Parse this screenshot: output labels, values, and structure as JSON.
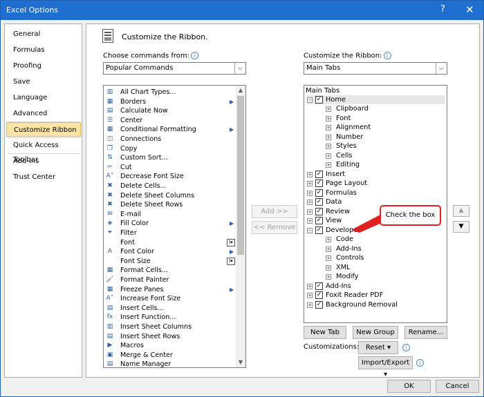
{
  "window": {
    "title": "Excel Options",
    "help_glyph": "?",
    "close_glyph": "✕"
  },
  "nav": {
    "items": [
      "General",
      "Formulas",
      "Proofing",
      "Save",
      "Language",
      "Advanced",
      "Customize Ribbon",
      "Quick Access Toolbar",
      "Add-Ins",
      "Trust Center"
    ],
    "selected": "Customize Ribbon"
  },
  "header": {
    "title": "Customize the Ribbon."
  },
  "left": {
    "label": "Choose commands from:",
    "combo_value": "Popular Commands",
    "commands": [
      {
        "label": "All Chart Types...",
        "icon": "chart-icon",
        "glyph": "▥"
      },
      {
        "label": "Borders",
        "icon": "borders-icon",
        "glyph": "▦",
        "submenu": true
      },
      {
        "label": "Calculate Now",
        "icon": "calculator-icon",
        "glyph": "▤"
      },
      {
        "label": "Center",
        "icon": "align-center-icon",
        "glyph": "☰"
      },
      {
        "label": "Conditional Formatting",
        "icon": "conditional-formatting-icon",
        "glyph": "▦",
        "submenu": true
      },
      {
        "label": "Connections",
        "icon": "connections-icon",
        "glyph": "◫"
      },
      {
        "label": "Copy",
        "icon": "copy-icon",
        "glyph": "❐"
      },
      {
        "label": "Custom Sort...",
        "icon": "sort-icon",
        "glyph": "⇅"
      },
      {
        "label": "Cut",
        "icon": "cut-icon",
        "glyph": "✂"
      },
      {
        "label": "Decrease Font Size",
        "icon": "decrease-font-icon",
        "glyph": "A˅"
      },
      {
        "label": "Delete Cells...",
        "icon": "delete-cells-icon",
        "glyph": "✖"
      },
      {
        "label": "Delete Sheet Columns",
        "icon": "delete-columns-icon",
        "glyph": "✖"
      },
      {
        "label": "Delete Sheet Rows",
        "icon": "delete-rows-icon",
        "glyph": "✖"
      },
      {
        "label": "E-mail",
        "icon": "email-icon",
        "glyph": "✉"
      },
      {
        "label": "Fill Color",
        "icon": "fill-color-icon",
        "glyph": "◈",
        "submenu": true
      },
      {
        "label": "Filter",
        "icon": "filter-icon",
        "glyph": "⏷"
      },
      {
        "label": "Font",
        "icon": "",
        "glyph": "",
        "spin": true
      },
      {
        "label": "Font Color",
        "icon": "font-color-icon",
        "glyph": "A",
        "submenu": true
      },
      {
        "label": "Font Size",
        "icon": "",
        "glyph": "",
        "spin": true
      },
      {
        "label": "Format Cells...",
        "icon": "format-cells-icon",
        "glyph": "▦"
      },
      {
        "label": "Format Painter",
        "icon": "format-painter-icon",
        "glyph": "🖌"
      },
      {
        "label": "Freeze Panes",
        "icon": "freeze-panes-icon",
        "glyph": "▦",
        "submenu": true
      },
      {
        "label": "Increase Font Size",
        "icon": "increase-font-icon",
        "glyph": "A˄"
      },
      {
        "label": "Insert Cells...",
        "icon": "insert-cells-icon",
        "glyph": "▤"
      },
      {
        "label": "Insert Function...",
        "icon": "function-icon",
        "glyph": "fx"
      },
      {
        "label": "Insert Sheet Columns",
        "icon": "insert-columns-icon",
        "glyph": "▥"
      },
      {
        "label": "Insert Sheet Rows",
        "icon": "insert-rows-icon",
        "glyph": "▤"
      },
      {
        "label": "Macros",
        "icon": "macros-icon",
        "glyph": "▶"
      },
      {
        "label": "Merge & Center",
        "icon": "merge-center-icon",
        "glyph": "▣"
      },
      {
        "label": "Name Manager",
        "icon": "name-manager-icon",
        "glyph": "▤"
      }
    ]
  },
  "middle": {
    "add_label": "Add >>",
    "remove_label": "<< Remove"
  },
  "right": {
    "label": "Customize the Ribbon:",
    "combo_value": "Main Tabs",
    "root_label": "Main Tabs",
    "tree": [
      {
        "label": "Home",
        "level": 0,
        "expander": "⊟",
        "checked": true
      },
      {
        "label": "Clipboard",
        "level": 1
      },
      {
        "label": "Font",
        "level": 1
      },
      {
        "label": "Alignment",
        "level": 1
      },
      {
        "label": "Number",
        "level": 1
      },
      {
        "label": "Styles",
        "level": 1
      },
      {
        "label": "Cells",
        "level": 1
      },
      {
        "label": "Editing",
        "level": 1
      },
      {
        "label": "Insert",
        "level": 0,
        "expander": "⊞",
        "checked": true
      },
      {
        "label": "Page Layout",
        "level": 0,
        "expander": "⊞",
        "checked": true
      },
      {
        "label": "Formulas",
        "level": 0,
        "expander": "⊞",
        "checked": true
      },
      {
        "label": "Data",
        "level": 0,
        "expander": "⊞",
        "checked": true
      },
      {
        "label": "Review",
        "level": 0,
        "expander": "⊞",
        "checked": true
      },
      {
        "label": "View",
        "level": 0,
        "expander": "⊞",
        "checked": true
      },
      {
        "label": "Developer",
        "level": 0,
        "expander": "⊟",
        "checked": true
      },
      {
        "label": "Code",
        "level": 1
      },
      {
        "label": "Add-Ins",
        "level": 1
      },
      {
        "label": "Controls",
        "level": 1
      },
      {
        "label": "XML",
        "level": 1
      },
      {
        "label": "Modify",
        "level": 1
      },
      {
        "label": "Add-Ins",
        "level": 0,
        "expander": "⊞",
        "checked": true
      },
      {
        "label": "Foxit Reader PDF",
        "level": 0,
        "expander": "⊞",
        "checked": true
      },
      {
        "label": "Background Removal",
        "level": 0,
        "expander": "⊞",
        "checked": true
      }
    ],
    "new_tab_label": "New Tab",
    "new_group_label": "New Group",
    "rename_label": "Rename...",
    "customizations_label": "Customizations:",
    "reset_label": "Reset ▾",
    "import_export_label": "Import/Export ▾"
  },
  "callout": {
    "text": "Check the box"
  },
  "footer": {
    "ok_label": "OK",
    "cancel_label": "Cancel"
  },
  "colors": {
    "titlebar": "#1f6fd1",
    "selection": "#fce4a6",
    "callout_border": "#e02020"
  }
}
